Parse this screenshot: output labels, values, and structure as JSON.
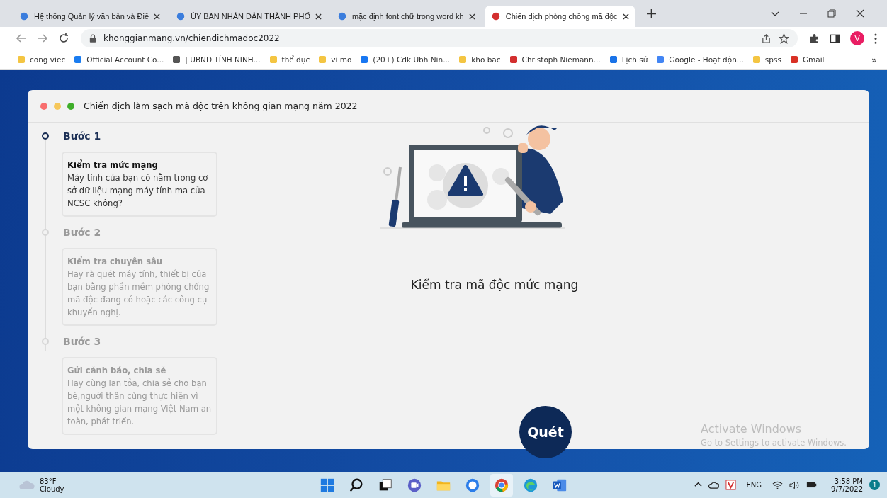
{
  "browser": {
    "tabs": [
      {
        "title": "Hệ thống Quản lý văn bản và Điề",
        "selected": false
      },
      {
        "title": "ỦY BAN NHÂN DÂN THÀNH PHỐ",
        "selected": false
      },
      {
        "title": "mặc định font chữ trong word kh",
        "selected": false
      },
      {
        "title": "Chiến dịch phòng chống mã độc",
        "selected": true
      }
    ],
    "address": "khonggianmang.vn/chiendichmadoc2022",
    "profile_initial": "V",
    "bookmarks": [
      "cong viec",
      "Official Account Co...",
      "| UBND TỈNH NINH...",
      "thể dục",
      "vi mo",
      "(20+) Cđk Ubh Nin...",
      "kho bac",
      "Christoph Niemann...",
      "Lịch sử",
      "Google - Hoạt độn...",
      "spss",
      "Gmail"
    ],
    "bookmarks_more": "»"
  },
  "card": {
    "title": "Chiến dịch làm sạch mã độc trên không gian mạng năm 2022",
    "steps": [
      {
        "label": "Bước 1",
        "heading": "Kiểm tra mức mạng",
        "body": "Máy tính của bạn có nằm trong cơ sở dữ liệu mạng máy tính ma của NCSC không?",
        "active": true
      },
      {
        "label": "Bước 2",
        "heading": "Kiểm tra chuyên sâu",
        "body": "Hãy rà quét máy tính, thiết bị của bạn bằng phần mềm phòng chống mã độc đang có hoặc các công cụ khuyến nghị.",
        "active": false
      },
      {
        "label": "Bước 3",
        "heading": "Gửi cảnh báo, chia sẻ",
        "body": "Hãy cùng lan tỏa, chia sẻ cho bạn bè,người thân cùng thực hiện vì một không gian mạng Việt Nam an toàn, phát triển.",
        "active": false
      }
    ],
    "caption": "Kiểm tra mã độc mức mạng",
    "scan_button": "Quét"
  },
  "activation_notice": {
    "title": "Activate Windows",
    "subtitle": "Go to Settings to activate Windows."
  },
  "taskbar": {
    "weather_temp": "83°F",
    "weather_text": "Cloudy",
    "language": "ENG",
    "time": "3:58 PM",
    "date": "9/7/2022",
    "notification_count": "1"
  }
}
